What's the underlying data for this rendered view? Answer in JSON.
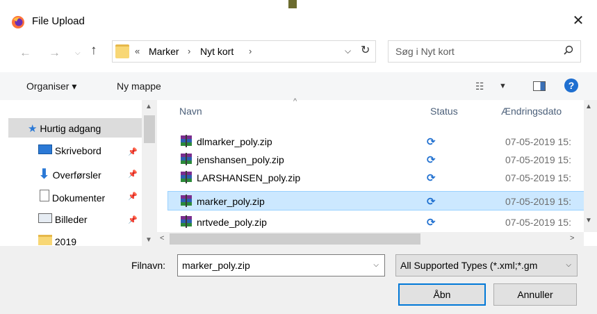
{
  "window": {
    "title": "File Upload",
    "close_glyph": "✕"
  },
  "nav": {
    "back_glyph": "←",
    "forward_glyph": "→",
    "recent_glyph": "⌵",
    "up_glyph": "↑",
    "refresh_glyph": "↻"
  },
  "address": {
    "overflow": "«",
    "crumbs": [
      "Marker",
      "Nyt kort"
    ],
    "separator": "›",
    "dropdown_glyph": "⌵"
  },
  "search": {
    "placeholder": "Søg i Nyt kort"
  },
  "toolbar": {
    "organise_label": "Organiser ▾",
    "new_folder_label": "Ny mappe",
    "view_glyph": "☷",
    "view_dropdown_glyph": "▼",
    "help_glyph": "?"
  },
  "sidebar": {
    "items": [
      {
        "label": "Hurtig adgang",
        "icon": "star-icon",
        "pinned": false,
        "selected": true
      },
      {
        "label": "Skrivebord",
        "icon": "desktop-icon",
        "pinned": true
      },
      {
        "label": "Overførsler",
        "icon": "download-icon",
        "pinned": true
      },
      {
        "label": "Dokumenter",
        "icon": "document-icon",
        "pinned": true
      },
      {
        "label": "Billeder",
        "icon": "pictures-icon",
        "pinned": true
      },
      {
        "label": "2019",
        "icon": "folder-icon",
        "pinned": false
      }
    ],
    "pin_glyph": "📌",
    "star_glyph": "★",
    "download_glyph": "⬇"
  },
  "files": {
    "columns": [
      "Navn",
      "Status",
      "Ændringsdato"
    ],
    "rows": [
      {
        "name": "dlmarker_poly.zip",
        "status_glyph": "⟳",
        "date": "07-05-2019 15:",
        "selected": false
      },
      {
        "name": "jenshansen_poly.zip",
        "status_glyph": "⟳",
        "date": "07-05-2019 15:",
        "selected": false
      },
      {
        "name": "LARSHANSEN_poly.zip",
        "status_glyph": "⟳",
        "date": "07-05-2019 15:",
        "selected": false
      },
      {
        "name": "marker_poly.zip",
        "status_glyph": "⟳",
        "date": "07-05-2019 15:",
        "selected": true
      },
      {
        "name": "nrtvede_poly.zip",
        "status_glyph": "⟳",
        "date": "07-05-2019 15:",
        "selected": false
      }
    ],
    "sort_glyph": "^"
  },
  "scroll": {
    "up": "▲",
    "down": "▼",
    "left": "<",
    "right": ">"
  },
  "footer": {
    "filename_label": "Filnavn:",
    "filename_value": "marker_poly.zip",
    "filetype_value": "All Supported Types (*.xml;*.gm",
    "dropdown_glyph": "▽",
    "open_label": "Åbn",
    "cancel_label": "Annuller"
  },
  "colors": {
    "accent": "#0078d7",
    "selection": "#cce8ff",
    "sync_blue": "#1e6fd0"
  }
}
